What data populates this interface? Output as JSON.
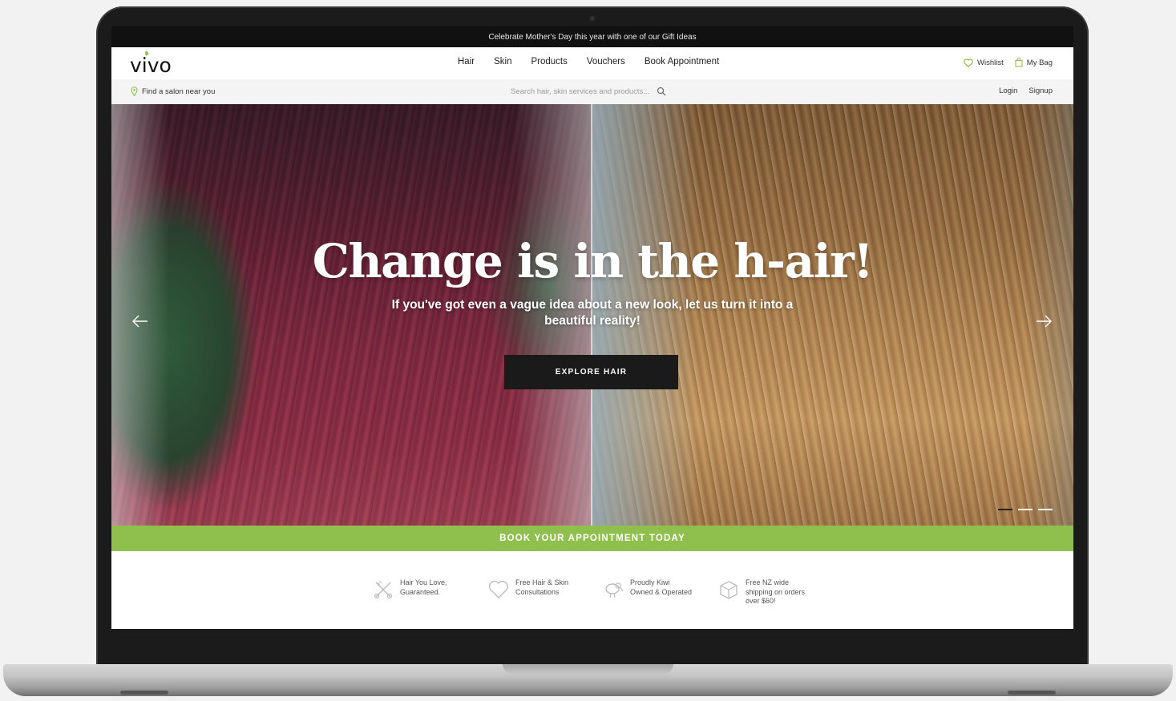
{
  "announcement": "Celebrate Mother's Day this year with one of our Gift Ideas",
  "header": {
    "logo": "vivo",
    "nav": [
      "Hair",
      "Skin",
      "Products",
      "Vouchers",
      "Book Appointment"
    ],
    "wishlist": "Wishlist",
    "bag": "My Bag"
  },
  "subbar": {
    "find_salon": "Find a salon near you",
    "search_placeholder": "Search hair, skin services and products...",
    "login": "Login",
    "signup": "Signup"
  },
  "hero": {
    "title": "Change is in the h-air!",
    "subtitle": "If you've got even a vague idea about a new look, let us turn it into a beautiful reality!",
    "cta": "EXPLORE HAIR",
    "slides": 3,
    "active_slide": 1
  },
  "book_bar": "BOOK YOUR APPOINTMENT TODAY",
  "features": [
    {
      "icon": "scissors-comb-icon",
      "text": "Hair You Love, Guaranteed."
    },
    {
      "icon": "heart-icon",
      "text": "Free Hair & Skin Consultations"
    },
    {
      "icon": "kiwi-bird-icon",
      "text": "Proudly Kiwi Owned & Operated"
    },
    {
      "icon": "box-icon",
      "text": "Free NZ wide shipping on orders over $60!"
    }
  ],
  "colors": {
    "brand_green": "#8fbf4d",
    "announcement_bg": "#111111",
    "cta_bg": "#1a1a1a"
  }
}
